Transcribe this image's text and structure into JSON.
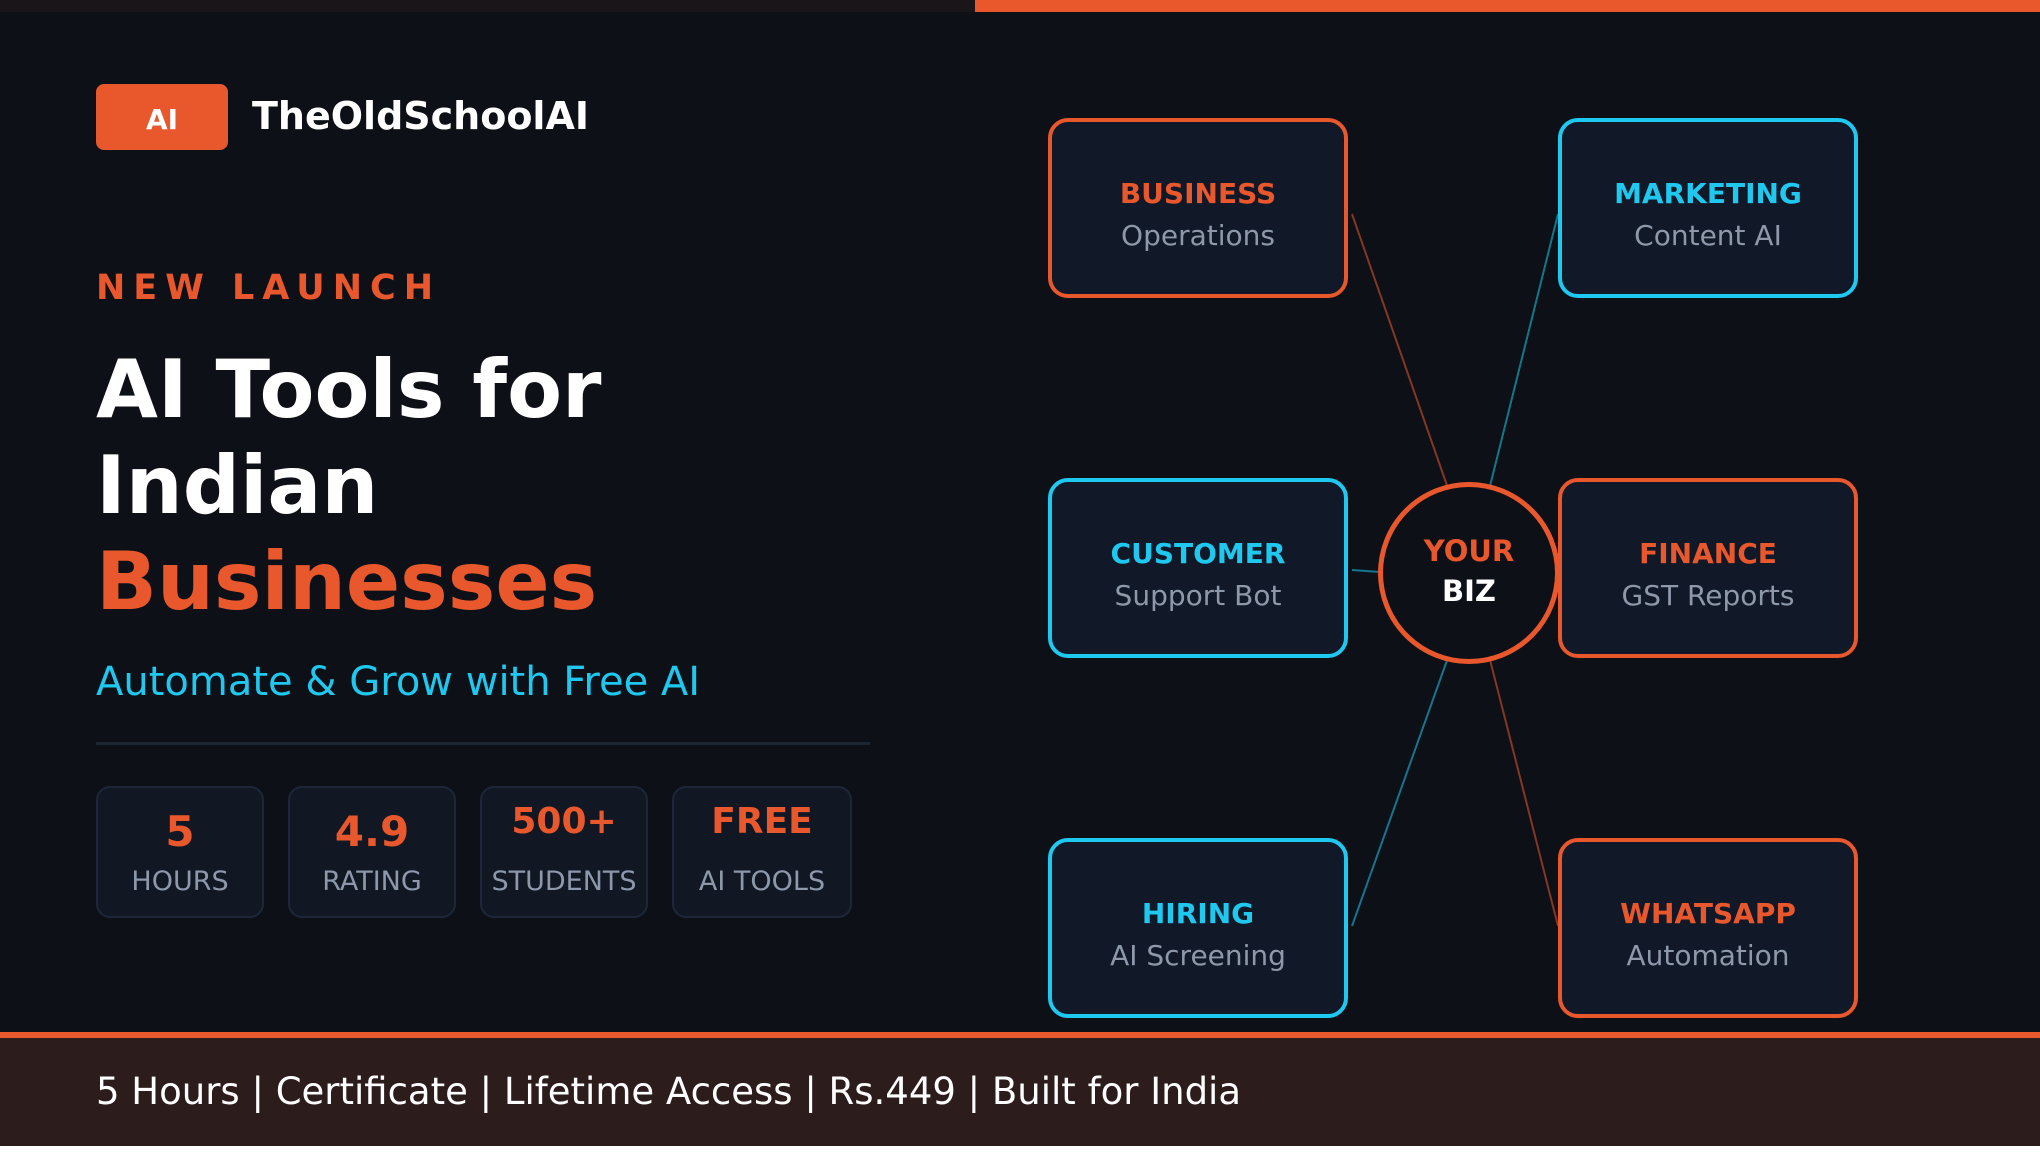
{
  "brand": {
    "badge": "AI",
    "name": "TheOldSchoolAI"
  },
  "hero": {
    "eyebrow": "NEW LAUNCH",
    "headline_line1": "AI Tools for",
    "headline_line2": "Indian",
    "headline_accent": "Businesses",
    "subhead": "Automate & Grow with Free AI"
  },
  "stats": [
    {
      "value": "5",
      "label": "HOURS"
    },
    {
      "value": "4.9",
      "label": "RATING"
    },
    {
      "value": "500+",
      "label": "STUDENTS"
    },
    {
      "value": "FREE",
      "label": "AI TOOLS"
    }
  ],
  "hub": {
    "top": "YOUR",
    "bottom": "BIZ"
  },
  "cards": [
    {
      "title": "BUSINESS",
      "subtitle": "Operations",
      "accent": "orange"
    },
    {
      "title": "MARKETING",
      "subtitle": "Content AI",
      "accent": "cyan"
    },
    {
      "title": "CUSTOMER",
      "subtitle": "Support Bot",
      "accent": "cyan"
    },
    {
      "title": "FINANCE",
      "subtitle": "GST Reports",
      "accent": "orange"
    },
    {
      "title": "HIRING",
      "subtitle": "AI Screening",
      "accent": "cyan"
    },
    {
      "title": "WHATSAPP",
      "subtitle": "Automation",
      "accent": "orange"
    }
  ],
  "footer": {
    "text": "5 Hours | Certificate | Lifetime Access | Rs.449 | Built for India"
  },
  "colors": {
    "background": "#0d1017",
    "accent_orange": "#e8582c",
    "accent_cyan": "#1ec8ef",
    "card_background": "#111827",
    "muted_text": "#8d98ab",
    "footer_background": "#2c1c1c"
  }
}
